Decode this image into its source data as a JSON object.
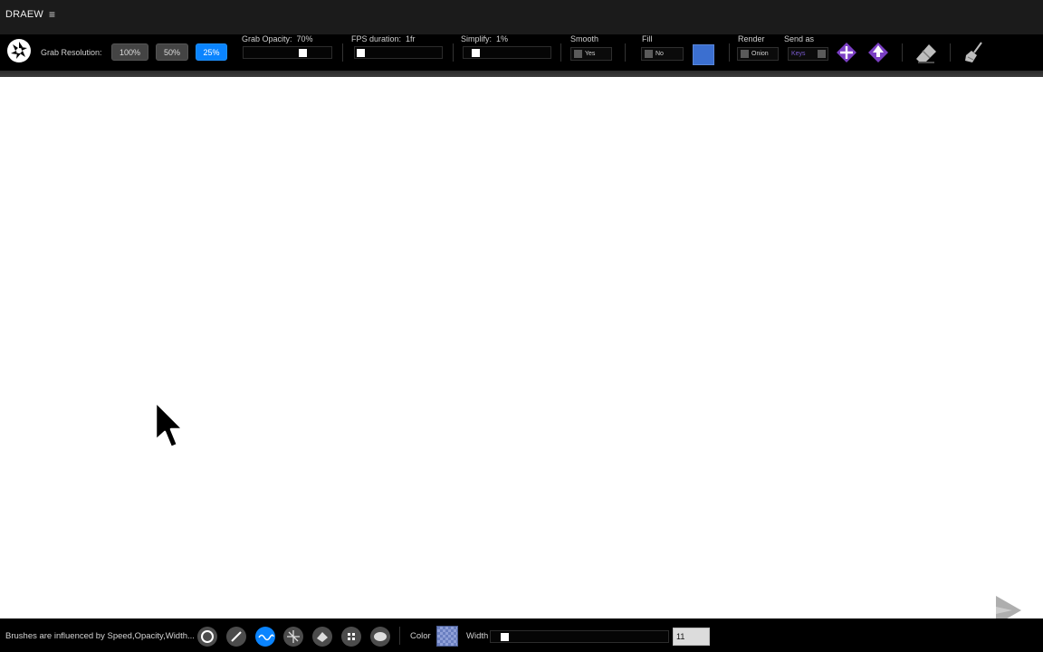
{
  "app": {
    "title": "DRAEW",
    "menu_glyph": "≡"
  },
  "toolbar": {
    "grab_resolution_label": "Grab Resolution:",
    "resolutions": [
      "100%",
      "50%",
      "25%"
    ],
    "selected_resolution": "25%",
    "grab_opacity_label": "Grab Opacity:",
    "grab_opacity_value": "70%",
    "grab_opacity_level": 0.7,
    "fps_label": "FPS duration:",
    "fps_value": "1fr",
    "simplify_label": "Simplify:",
    "simplify_value": "1%",
    "smooth_label": "Smooth",
    "smooth_value": "Yes",
    "fill_label": "Fill",
    "fill_value": "No",
    "fill_color": "#3b6fd0",
    "render_label": "Render",
    "render_value": "Onion",
    "send_as_label": "Send as",
    "send_as_value": "Keys",
    "icons": [
      "shutter-icon",
      "add-keyframe-icon",
      "export-keyframe-icon",
      "eraser-icon",
      "broom-icon"
    ]
  },
  "bottombar": {
    "hint": "Brushes are influenced by Speed,Opacity,Width...",
    "brushes": [
      "circle-brush-icon",
      "line-brush-icon",
      "wave-brush-icon",
      "star-brush-icon",
      "stamp-brush-icon",
      "grid-brush-icon",
      "blob-brush-icon"
    ],
    "active_brush": "wave-brush-icon",
    "color_label": "Color",
    "width_label": "Width",
    "width_value": "11"
  },
  "colors": {
    "accent": "#0a84ff",
    "toolbar_bg": "#000000",
    "title_bg": "#1b1b1b",
    "canvas_bg": "#ffffff",
    "keyframe_purple": "#7b3fc4"
  }
}
